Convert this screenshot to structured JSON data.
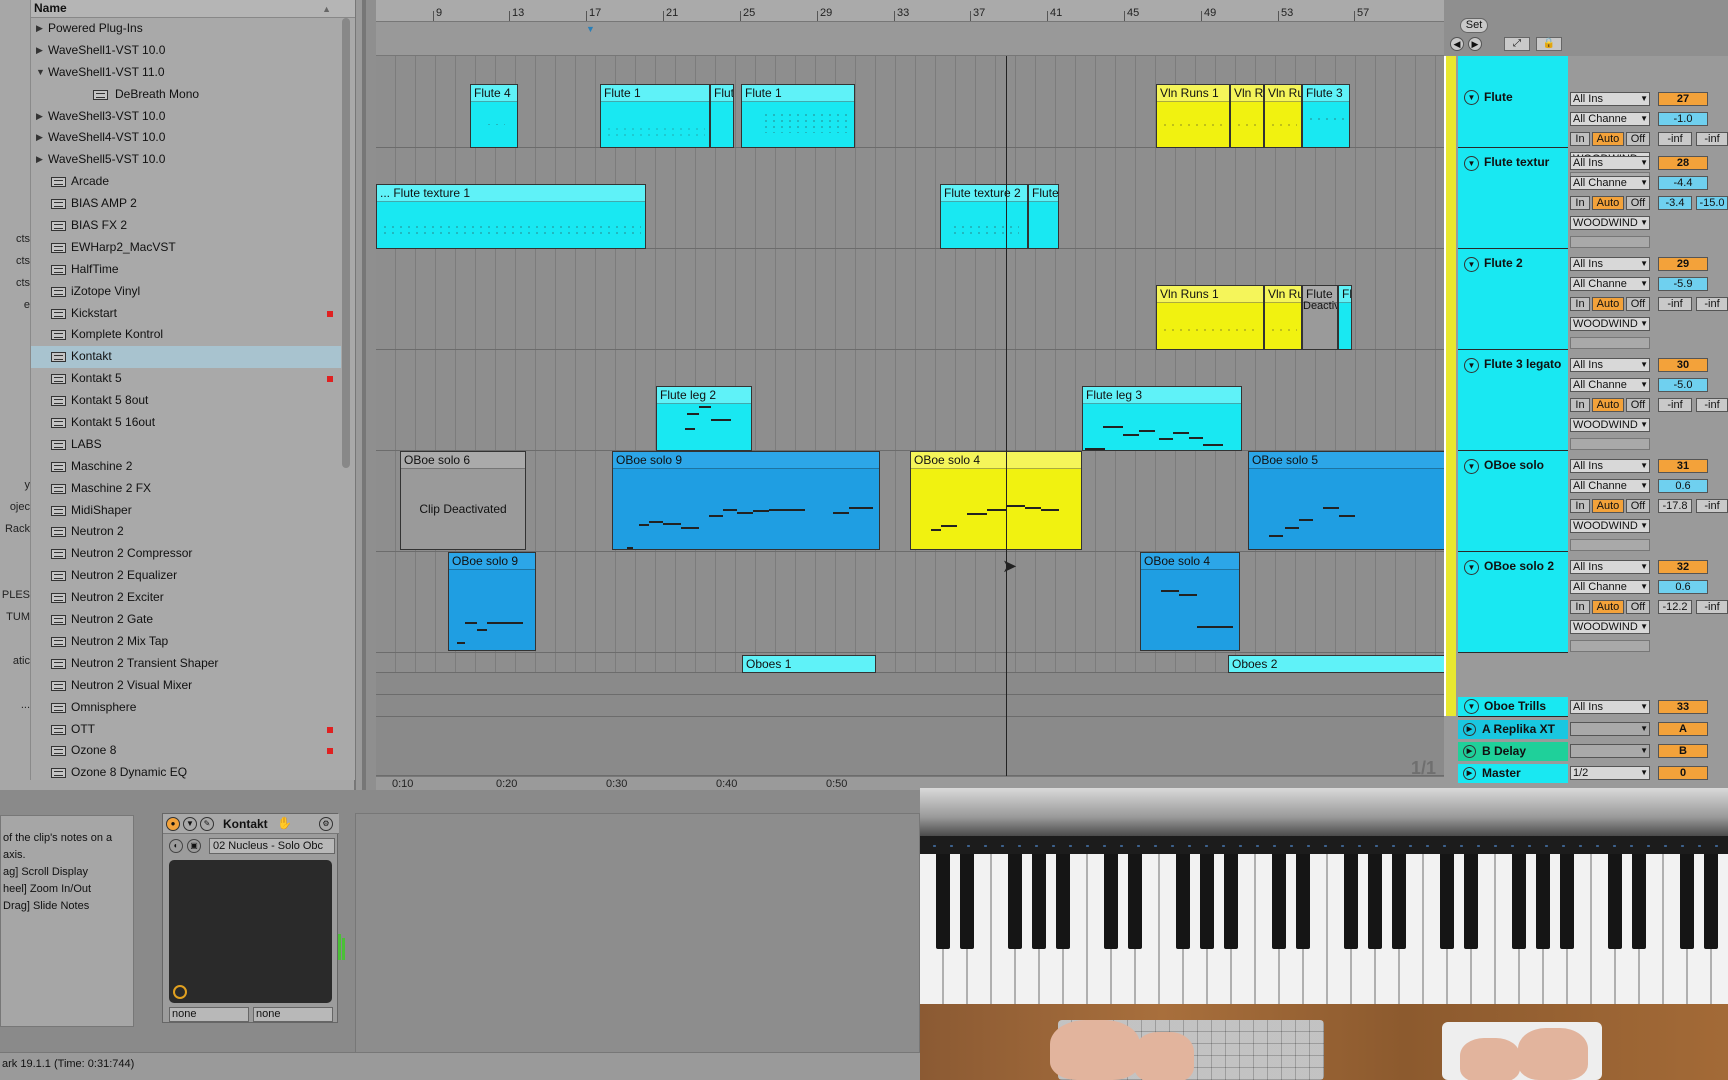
{
  "browser": {
    "header": "Name",
    "items": [
      {
        "label": "Powered Plug-Ins",
        "type": "folder",
        "open": false
      },
      {
        "label": "WaveShell1-VST 10.0",
        "type": "folder",
        "open": false
      },
      {
        "label": "WaveShell1-VST 11.0",
        "type": "folder",
        "open": true
      },
      {
        "label": "DeBreath Mono",
        "type": "subplugin"
      },
      {
        "label": "WaveShell3-VST 10.0",
        "type": "folder",
        "open": false
      },
      {
        "label": "WaveShell4-VST 10.0",
        "type": "folder",
        "open": false
      },
      {
        "label": "WaveShell5-VST 10.0",
        "type": "folder",
        "open": false
      },
      {
        "label": "Arcade",
        "type": "plugin"
      },
      {
        "label": "BIAS AMP 2",
        "type": "plugin"
      },
      {
        "label": "BIAS FX 2",
        "type": "plugin"
      },
      {
        "label": "EWHarp2_MacVST",
        "type": "plugin"
      },
      {
        "label": "HalfTime",
        "type": "plugin"
      },
      {
        "label": "iZotope Vinyl",
        "type": "plugin"
      },
      {
        "label": "Kickstart",
        "type": "plugin",
        "flag": true
      },
      {
        "label": "Komplete Kontrol",
        "type": "plugin"
      },
      {
        "label": "Kontakt",
        "type": "plugin",
        "selected": true
      },
      {
        "label": "Kontakt 5",
        "type": "plugin",
        "flag": true
      },
      {
        "label": "Kontakt 5 8out",
        "type": "plugin"
      },
      {
        "label": "Kontakt 5 16out",
        "type": "plugin"
      },
      {
        "label": "LABS",
        "type": "plugin"
      },
      {
        "label": "Maschine 2",
        "type": "plugin"
      },
      {
        "label": "Maschine 2 FX",
        "type": "plugin"
      },
      {
        "label": "MidiShaper",
        "type": "plugin"
      },
      {
        "label": "Neutron 2",
        "type": "plugin"
      },
      {
        "label": "Neutron 2 Compressor",
        "type": "plugin"
      },
      {
        "label": "Neutron 2 Equalizer",
        "type": "plugin"
      },
      {
        "label": "Neutron 2 Exciter",
        "type": "plugin"
      },
      {
        "label": "Neutron 2 Gate",
        "type": "plugin"
      },
      {
        "label": "Neutron 2 Mix Tap",
        "type": "plugin"
      },
      {
        "label": "Neutron 2 Transient Shaper",
        "type": "plugin"
      },
      {
        "label": "Neutron 2 Visual Mixer",
        "type": "plugin"
      },
      {
        "label": "Omnisphere",
        "type": "plugin"
      },
      {
        "label": "OTT",
        "type": "plugin",
        "flag": true
      },
      {
        "label": "Ozone 8",
        "type": "plugin",
        "flag": true
      },
      {
        "label": "Ozone 8 Dynamic EQ",
        "type": "plugin"
      }
    ],
    "left_cut_labels": [
      "cts",
      "cts",
      "cts",
      "e",
      "y",
      "ojec",
      "Rack",
      "PLES",
      "TUM",
      "atic",
      "..."
    ]
  },
  "ruler": {
    "bars": [
      "9",
      "13",
      "17",
      "21",
      "25",
      "29",
      "33",
      "37",
      "41",
      "45",
      "49",
      "53",
      "57"
    ],
    "times": [
      "0:10",
      "0:20",
      "0:30",
      "0:40",
      "0:50"
    ]
  },
  "clips": {
    "flute4": "Flute 4",
    "flute1a": "Flute 1",
    "flut": "Flut",
    "flute1b": "Flute 1",
    "vln_runs1a": "Vln Runs 1",
    "vln_ru": "Vln Ru",
    "vln_run": "Vln Run",
    "flute3": "Flute 3",
    "flute_texture1": "... Flute texture 1",
    "flute_texture2": "Flute texture 2",
    "flute_small": "Flute",
    "vln_runs1b": "Vln Runs 1",
    "vln_ru2": "Vln Ru",
    "flute_deact": "Flute",
    "deactiv": "Deactiv",
    "fl": "Fl",
    "flute_leg2": "Flute leg 2",
    "flute_leg3": "Flute leg 3",
    "oboe6": "OBoe solo 6",
    "clip_deactivated": "Clip Deactivated",
    "oboe9a": "OBoe solo 9",
    "oboe4a": "OBoe solo 4",
    "oboe5": "OBoe solo 5",
    "oboe9b": "OBoe solo 9",
    "oboe4b": "OBoe solo 4",
    "oboes1": "Oboes 1",
    "oboes2": "Oboes 2"
  },
  "counter": "1/1",
  "set_label": "Set",
  "tracks": [
    {
      "name": "Flute",
      "input": "All Ins",
      "channel": "All Channe",
      "mon_in": "In",
      "mon_auto": "Auto",
      "mon_off": "Off",
      "out": "WOODWIND",
      "num": "27",
      "vol": "-1.0",
      "peak1": "-inf",
      "peak2": "-inf"
    },
    {
      "name": "Flute textur",
      "input": "All Ins",
      "channel": "All Channe",
      "mon_in": "In",
      "mon_auto": "Auto",
      "mon_off": "Off",
      "out": "WOODWIND",
      "num": "28",
      "vol": "-4.4",
      "peak1": "-3.4",
      "peak2": "-15.0"
    },
    {
      "name": "Flute 2",
      "input": "All Ins",
      "channel": "All Channe",
      "mon_in": "In",
      "mon_auto": "Auto",
      "mon_off": "Off",
      "out": "WOODWIND",
      "num": "29",
      "vol": "-5.9",
      "peak1": "-inf",
      "peak2": "-inf"
    },
    {
      "name": "Flute 3 legato",
      "input": "All Ins",
      "channel": "All Channe",
      "mon_in": "In",
      "mon_auto": "Auto",
      "mon_off": "Off",
      "out": "WOODWIND",
      "num": "30",
      "vol": "-5.0",
      "peak1": "-inf",
      "peak2": "-inf"
    },
    {
      "name": "OBoe solo",
      "input": "All Ins",
      "channel": "All Channe",
      "mon_in": "In",
      "mon_auto": "Auto",
      "mon_off": "Off",
      "out": "WOODWIND",
      "num": "31",
      "vol": "0.6",
      "peak1": "-17.8",
      "peak2": "-inf"
    },
    {
      "name": "OBoe solo 2",
      "input": "All Ins",
      "channel": "All Channe",
      "mon_in": "In",
      "mon_auto": "Auto",
      "mon_off": "Off",
      "out": "WOODWIND",
      "num": "32",
      "vol": "0.6",
      "peak1": "-12.2",
      "peak2": "-inf"
    }
  ],
  "oboe_trills": {
    "name": "Oboe Trills",
    "input": "All Ins",
    "num": "33"
  },
  "returns": [
    {
      "name": "A Replika XT",
      "letter": "A",
      "color": "#19c7e0"
    },
    {
      "name": "B Delay",
      "letter": "B",
      "color": "#1fd09a"
    },
    {
      "name": "Master",
      "letter": "0",
      "out": "1/2",
      "color": "#19e8f2"
    }
  ],
  "info_text": [
    "of the clip's notes on a",
    "axis.",
    "",
    "ag] Scroll Display",
    "heel] Zoom In/Out",
    " Drag] Slide Notes"
  ],
  "device": {
    "name": "Kontakt",
    "preset": "02 Nucleus - Solo Obc",
    "drop1": "none",
    "drop2": "none"
  },
  "status_text": "ark 19.1.1 (Time: 0:31:744)"
}
